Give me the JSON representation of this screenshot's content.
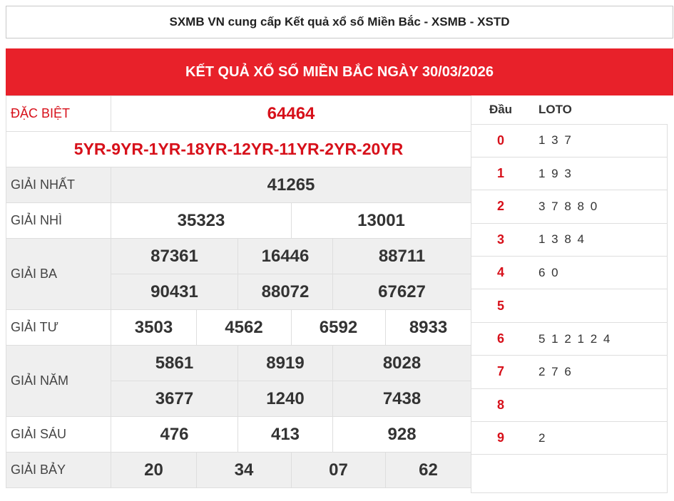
{
  "banner": {
    "text": "SXMB VN cung cấp Kết quả xổ số Miền Bắc - XSMB - XSTD"
  },
  "header": {
    "title": "KẾT QUẢ XỔ SỐ MIỀN BẮC NGÀY 30/03/2026"
  },
  "results": {
    "special": {
      "label": "ĐẶC BIỆT",
      "number": "64464"
    },
    "codes": "5YR-9YR-1YR-18YR-12YR-11YR-2YR-20YR",
    "first": {
      "label": "GIẢI NHẤT",
      "numbers": [
        "41265"
      ]
    },
    "second": {
      "label": "GIẢI NHÌ",
      "numbers": [
        "35323",
        "13001"
      ]
    },
    "third": {
      "label": "GIẢI BA",
      "numbers": [
        "87361",
        "16446",
        "88711",
        "90431",
        "88072",
        "67627"
      ]
    },
    "fourth": {
      "label": "GIẢI TƯ",
      "numbers": [
        "3503",
        "4562",
        "6592",
        "8933"
      ]
    },
    "fifth": {
      "label": "GIẢI NĂM",
      "numbers": [
        "5861",
        "8919",
        "8028",
        "3677",
        "1240",
        "7438"
      ]
    },
    "sixth": {
      "label": "GIẢI SÁU",
      "numbers": [
        "476",
        "413",
        "928"
      ]
    },
    "seventh": {
      "label": "GIẢI BẢY",
      "numbers": [
        "20",
        "34",
        "07",
        "62"
      ]
    }
  },
  "loto": {
    "head_label": "Đầu",
    "loto_label": "LOTO",
    "rows": [
      {
        "dau": "0",
        "nums": "1 3 7"
      },
      {
        "dau": "1",
        "nums": "1 9 3"
      },
      {
        "dau": "2",
        "nums": "3 7 8 8 0"
      },
      {
        "dau": "3",
        "nums": "1 3 8 4"
      },
      {
        "dau": "4",
        "nums": "6 0"
      },
      {
        "dau": "5",
        "nums": ""
      },
      {
        "dau": "6",
        "nums": "5 1 2 1 2 4"
      },
      {
        "dau": "7",
        "nums": "2 7 6"
      },
      {
        "dau": "8",
        "nums": ""
      },
      {
        "dau": "9",
        "nums": "2"
      }
    ]
  },
  "colors": {
    "accent_red": "#e8212a",
    "text_red": "#d7101a"
  }
}
